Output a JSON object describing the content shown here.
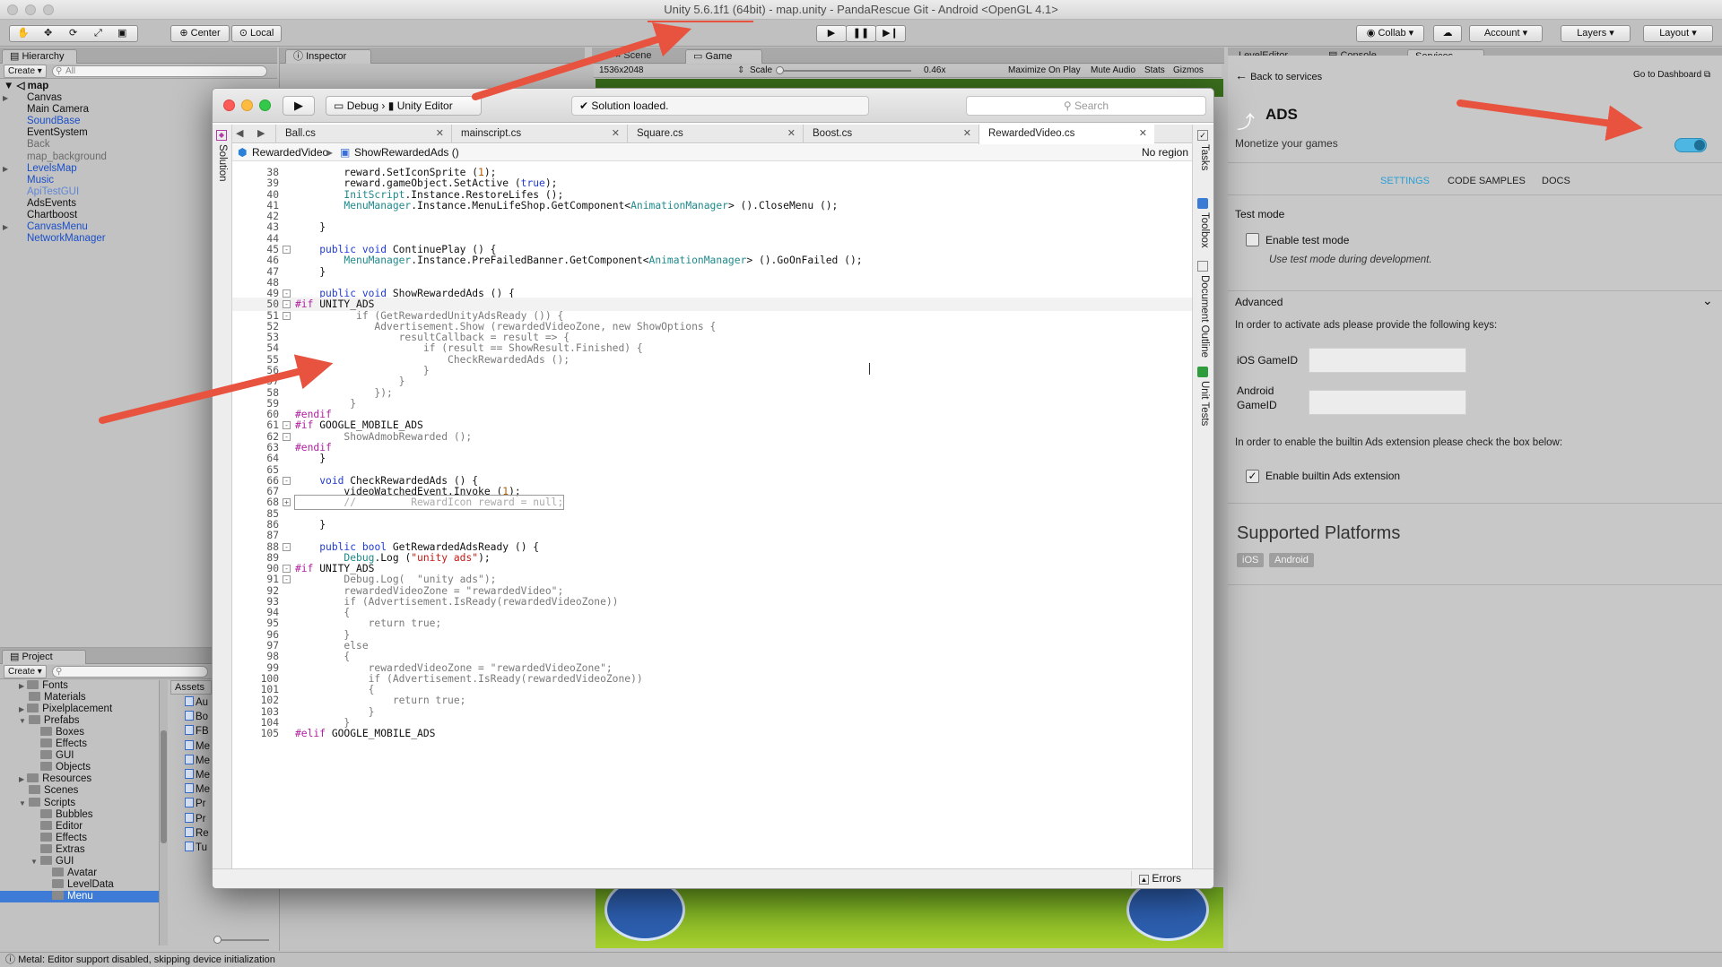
{
  "window_title": "Unity 5.6.1f1 (64bit) - map.unity - PandaRescue Git - Android <OpenGL 4.1>",
  "toolbar": {
    "tools": [
      "hand-icon",
      "move-icon",
      "rotate-icon",
      "scale-icon",
      "rect-icon"
    ],
    "center": "Center",
    "local": "Local",
    "collab": "Collab",
    "account": "Account",
    "layers": "Layers",
    "layout": "Layout"
  },
  "hierarchy": {
    "tab": "Hierarchy",
    "create": "Create",
    "search_placeholder": "All",
    "scene": "map",
    "items": [
      {
        "label": "Canvas",
        "color": "#111111",
        "arrow": true
      },
      {
        "label": "Main Camera",
        "color": "#111111",
        "arrow": false
      },
      {
        "label": "SoundBase",
        "color": "#1a4fc9",
        "arrow": false
      },
      {
        "label": "EventSystem",
        "color": "#111111",
        "arrow": false
      },
      {
        "label": "Back",
        "color": "#6b6b6b",
        "arrow": false
      },
      {
        "label": "map_background",
        "color": "#6b6b6b",
        "arrow": false
      },
      {
        "label": "LevelsMap",
        "color": "#1a4fc9",
        "arrow": true
      },
      {
        "label": "Music",
        "color": "#1a4fc9",
        "arrow": false
      },
      {
        "label": "ApiTestGUI",
        "color": "#5f86d6",
        "arrow": false
      },
      {
        "label": "AdsEvents",
        "color": "#111111",
        "arrow": false
      },
      {
        "label": "Chartboost",
        "color": "#111111",
        "arrow": false
      },
      {
        "label": "CanvasMenu",
        "color": "#1a4fc9",
        "arrow": true
      },
      {
        "label": "NetworkManager",
        "color": "#1a4fc9",
        "arrow": false
      }
    ]
  },
  "inspector_tab": "Inspector",
  "scene_tab": "Scene",
  "game": {
    "tab": "Game",
    "resolution": "1536x2048",
    "scale_label": "Scale",
    "scale_value": "0.46x",
    "maximize": "Maximize On Play",
    "mute": "Mute Audio",
    "stats": "Stats",
    "gizmos": "Gizmos"
  },
  "project": {
    "tab": "Project",
    "create": "Create",
    "assets_header": "Assets",
    "folders": [
      {
        "label": "Fonts",
        "level": 1,
        "arrow": "right"
      },
      {
        "label": "Materials",
        "level": 1,
        "arrow": ""
      },
      {
        "label": "Pixelplacement",
        "level": 1,
        "arrow": "right"
      },
      {
        "label": "Prefabs",
        "level": 1,
        "arrow": "down"
      },
      {
        "label": "Boxes",
        "level": 2,
        "arrow": ""
      },
      {
        "label": "Effects",
        "level": 2,
        "arrow": ""
      },
      {
        "label": "GUI",
        "level": 2,
        "arrow": ""
      },
      {
        "label": "Objects",
        "level": 2,
        "arrow": ""
      },
      {
        "label": "Resources",
        "level": 1,
        "arrow": "right"
      },
      {
        "label": "Scenes",
        "level": 1,
        "arrow": ""
      },
      {
        "label": "Scripts",
        "level": 1,
        "arrow": "down"
      },
      {
        "label": "Bubbles",
        "level": 2,
        "arrow": ""
      },
      {
        "label": "Editor",
        "level": 2,
        "arrow": ""
      },
      {
        "label": "Effects",
        "level": 2,
        "arrow": ""
      },
      {
        "label": "Extras",
        "level": 2,
        "arrow": ""
      },
      {
        "label": "GUI",
        "level": 2,
        "arrow": "down"
      },
      {
        "label": "Avatar",
        "level": 3,
        "arrow": ""
      },
      {
        "label": "LevelData",
        "level": 3,
        "arrow": ""
      },
      {
        "label": "Menu",
        "level": 3,
        "arrow": "",
        "selected": true
      }
    ],
    "asset_files": [
      "Au",
      "Bo",
      "FB",
      "Me",
      "Me",
      "Me",
      "Me",
      "Pr",
      "Pr",
      "Re",
      "Tu"
    ]
  },
  "editor": {
    "config": "Debug",
    "target": "Unity Editor",
    "status": "Solution loaded.",
    "search_placeholder": "Search",
    "tabs": [
      "Ball.cs",
      "mainscript.cs",
      "Square.cs",
      "Boost.cs",
      "RewardedVideo.cs"
    ],
    "active_tab": 4,
    "breadcrumb_class": "RewardedVideo",
    "breadcrumb_method": "ShowRewardedAds ()",
    "region": "No region",
    "left_pad": "Solution",
    "right_pads": [
      "Tasks",
      "Toolbox",
      "Document Outline",
      "Unit Tests"
    ],
    "errors": "Errors",
    "lines": [
      {
        "n": "38",
        "fold": "",
        "code": "        reward.SetIconSprite (1);"
      },
      {
        "n": "39",
        "fold": "",
        "code": "        reward.gameObject.SetActive (true);"
      },
      {
        "n": "40",
        "fold": "",
        "code": "        InitScript.Instance.RestoreLifes ();"
      },
      {
        "n": "41",
        "fold": "",
        "code": "        MenuManager.Instance.MenuLifeShop.GetComponent<AnimationManager> ().CloseMenu ();"
      },
      {
        "n": "42",
        "fold": "",
        "code": ""
      },
      {
        "n": "43",
        "fold": "",
        "code": "    }"
      },
      {
        "n": "44",
        "fold": "",
        "code": ""
      },
      {
        "n": "45",
        "fold": "-",
        "code": "    public void ContinuePlay () {"
      },
      {
        "n": "46",
        "fold": "",
        "code": "        MenuManager.Instance.PreFailedBanner.GetComponent<AnimationManager> ().GoOnFailed ();"
      },
      {
        "n": "47",
        "fold": "",
        "code": "    }"
      },
      {
        "n": "48",
        "fold": "",
        "code": ""
      },
      {
        "n": "49",
        "fold": "-",
        "code": "    public void ShowRewardedAds () {"
      },
      {
        "n": "50",
        "fold": "-",
        "code": "#if UNITY_ADS",
        "hl": true
      },
      {
        "n": "51",
        "fold": "-",
        "code": "          if (GetRewardedUnityAdsReady ()) {",
        "dim": true
      },
      {
        "n": "52",
        "fold": "",
        "code": "             Advertisement.Show (rewardedVideoZone, new ShowOptions {",
        "dim": true
      },
      {
        "n": "53",
        "fold": "",
        "code": "                 resultCallback = result => {",
        "dim": true
      },
      {
        "n": "54",
        "fold": "",
        "code": "                     if (result == ShowResult.Finished) {",
        "dim": true
      },
      {
        "n": "55",
        "fold": "",
        "code": "                         CheckRewardedAds ();",
        "dim": true
      },
      {
        "n": "56",
        "fold": "",
        "code": "                     }",
        "dim": true
      },
      {
        "n": "57",
        "fold": "",
        "code": "                 }",
        "dim": true
      },
      {
        "n": "58",
        "fold": "",
        "code": "             });",
        "dim": true
      },
      {
        "n": "59",
        "fold": "",
        "code": "         }",
        "dim": true
      },
      {
        "n": "60",
        "fold": "",
        "code": "#endif"
      },
      {
        "n": "61",
        "fold": "-",
        "code": "#if GOOGLE_MOBILE_ADS"
      },
      {
        "n": "62",
        "fold": "-",
        "code": "        ShowAdmobRewarded ();",
        "dim": true
      },
      {
        "n": "63",
        "fold": "",
        "code": "#endif"
      },
      {
        "n": "64",
        "fold": "",
        "code": "    }"
      },
      {
        "n": "65",
        "fold": "",
        "code": ""
      },
      {
        "n": "66",
        "fold": "-",
        "code": "    void CheckRewardedAds () {"
      },
      {
        "n": "67",
        "fold": "",
        "code": "        videoWatchedEvent.Invoke (1);"
      },
      {
        "n": "68",
        "fold": "+",
        "code": "        //         RewardIcon reward = null;",
        "boxed": true
      },
      {
        "n": "85",
        "fold": "",
        "code": ""
      },
      {
        "n": "86",
        "fold": "",
        "code": "    }"
      },
      {
        "n": "87",
        "fold": "",
        "code": ""
      },
      {
        "n": "88",
        "fold": "-",
        "code": "    public bool GetRewardedAdsReady () {"
      },
      {
        "n": "89",
        "fold": "",
        "code": "        Debug.Log (\"unity ads\");"
      },
      {
        "n": "90",
        "fold": "-",
        "code": "#if UNITY_ADS"
      },
      {
        "n": "91",
        "fold": "-",
        "code": "        Debug.Log(  \"unity ads\");",
        "dim": true
      },
      {
        "n": "92",
        "fold": "",
        "code": "        rewardedVideoZone = \"rewardedVideo\";",
        "dim": true
      },
      {
        "n": "93",
        "fold": "",
        "code": "        if (Advertisement.IsReady(rewardedVideoZone))",
        "dim": true
      },
      {
        "n": "94",
        "fold": "",
        "code": "        {",
        "dim": true
      },
      {
        "n": "95",
        "fold": "",
        "code": "            return true;",
        "dim": true
      },
      {
        "n": "96",
        "fold": "",
        "code": "        }",
        "dim": true
      },
      {
        "n": "97",
        "fold": "",
        "code": "        else",
        "dim": true
      },
      {
        "n": "98",
        "fold": "",
        "code": "        {",
        "dim": true
      },
      {
        "n": "99",
        "fold": "",
        "code": "            rewardedVideoZone = \"rewardedVideoZone\";",
        "dim": true
      },
      {
        "n": "100",
        "fold": "",
        "code": "            if (Advertisement.IsReady(rewardedVideoZone))",
        "dim": true
      },
      {
        "n": "101",
        "fold": "",
        "code": "            {",
        "dim": true
      },
      {
        "n": "102",
        "fold": "",
        "code": "                return true;",
        "dim": true
      },
      {
        "n": "103",
        "fold": "",
        "code": "            }",
        "dim": true
      },
      {
        "n": "104",
        "fold": "",
        "code": "        }",
        "dim": true
      },
      {
        "n": "105",
        "fold": "",
        "code": "#elif GOOGLE_MOBILE_ADS"
      }
    ]
  },
  "services": {
    "tabs": [
      "LevelEditor",
      "Console",
      "Services"
    ],
    "back": "Back to services",
    "dashboard": "Go to Dashboard",
    "title": "ADS",
    "subtitle": "Monetize your games",
    "subtabs": [
      "SETTINGS",
      "CODE SAMPLES",
      "DOCS"
    ],
    "test_mode_header": "Test mode",
    "enable_test_mode": "Enable test mode",
    "test_mode_hint": "Use test mode during development.",
    "advanced": "Advanced",
    "keys_text": "In order to activate ads please provide the following keys:",
    "ios_gameid": "iOS GameID",
    "android_gameid": "Android GameID",
    "builtin_text": "In order to enable the builtin Ads extension please check the box below:",
    "builtin_label": "Enable builtin Ads extension",
    "platforms_title": "Supported Platforms",
    "platforms": [
      "iOS",
      "Android"
    ]
  },
  "status_bar": "Metal: Editor support disabled, skipping device initialization",
  "colors": {
    "accent_blue": "#2a9fd6",
    "toggle_on": "#4db6e2",
    "arrow_red": "#e8533f",
    "keyword_blue": "#1f3ad6",
    "type_teal": "#1f8a8c",
    "preproc_magenta": "#b01fa0",
    "string_red": "#c41a16"
  }
}
